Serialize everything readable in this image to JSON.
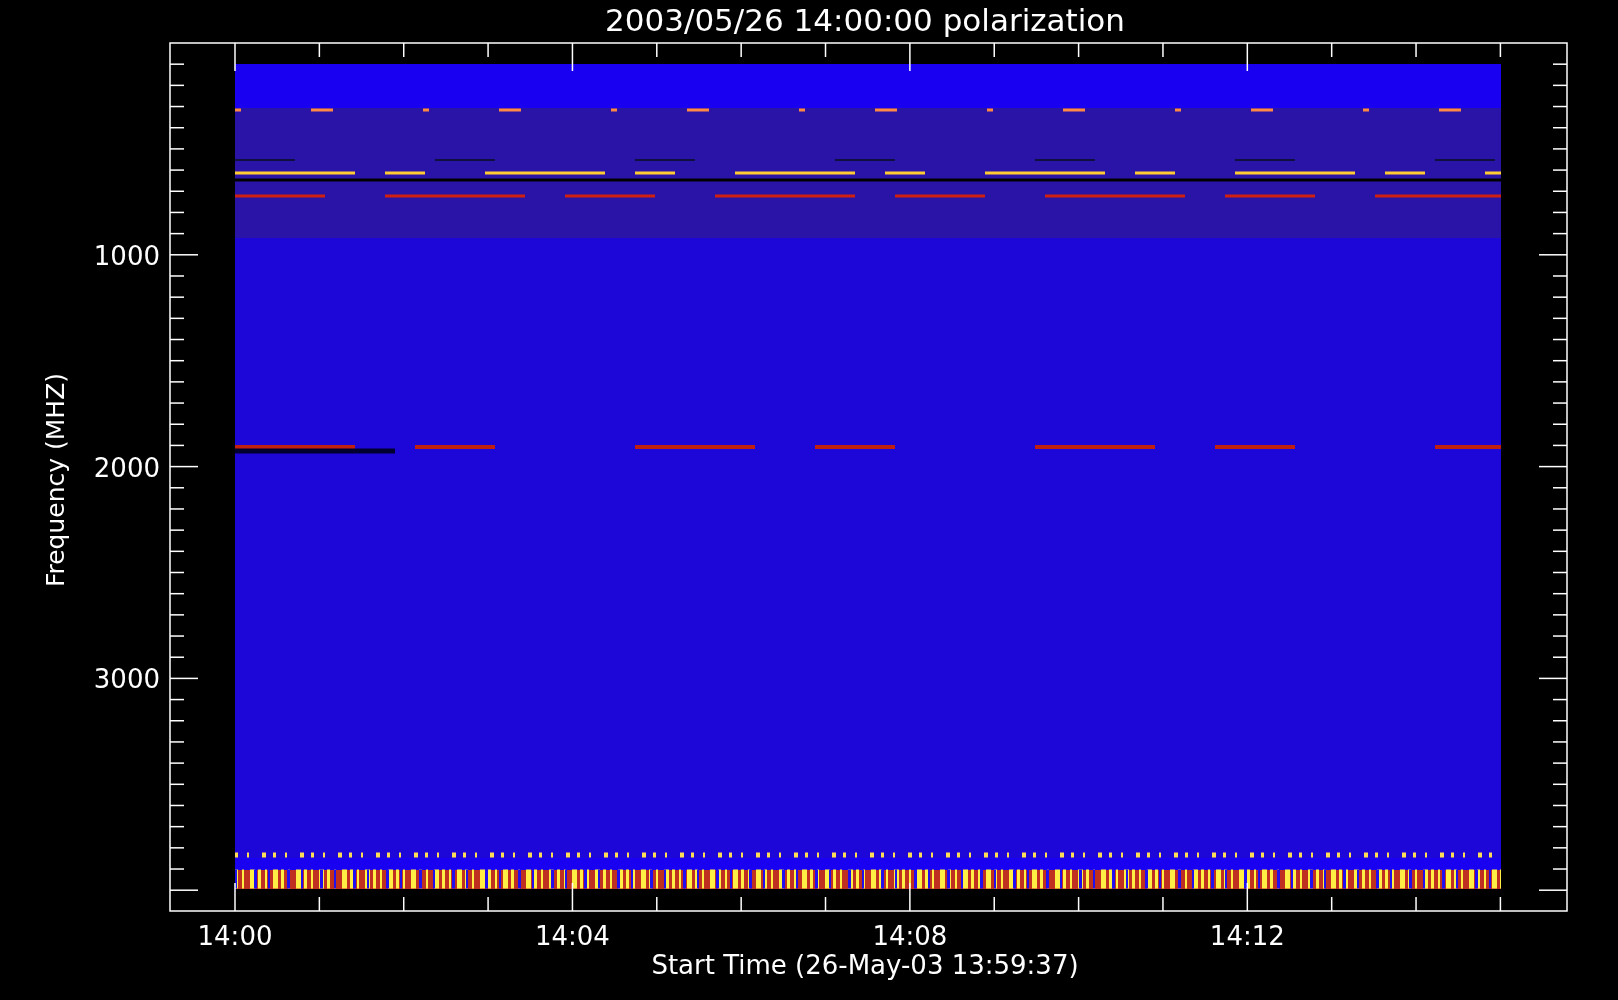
{
  "title": "2003/05/26 14:00:00 polarization",
  "y_axis": {
    "title": "Frequency (MHZ)",
    "ticks": [
      "1000",
      "2000",
      "3000"
    ]
  },
  "x_axis": {
    "title": "Start Time (26-May-03 13:59:37)",
    "ticks": [
      "14:00",
      "14:04",
      "14:08",
      "14:12"
    ]
  }
}
